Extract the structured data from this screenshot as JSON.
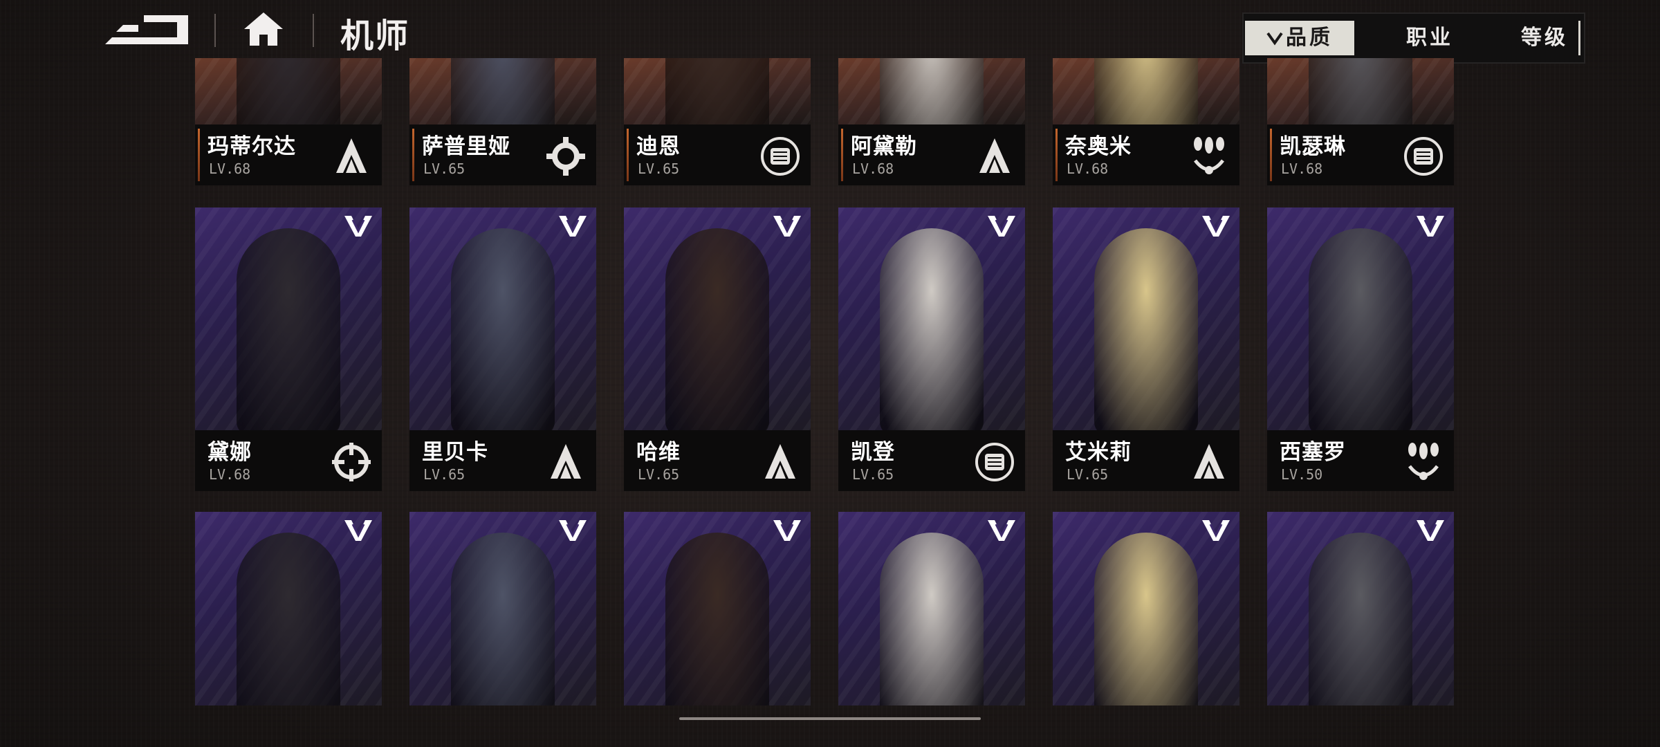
{
  "header": {
    "title": "机师",
    "back_icon": "back-arrow-icon",
    "home_icon": "home-icon"
  },
  "sort": {
    "quality": "品质",
    "job": "职业",
    "level": "等级",
    "quality_indicator": "chevron-down-icon"
  },
  "rows": [
    {
      "cards": [
        {
          "name": "玛蒂尔达",
          "level": "LV.68",
          "job_icon": "lance-icon"
        },
        {
          "name": "萨普里娅",
          "level": "LV.65",
          "job_icon": "wrench-icon"
        },
        {
          "name": "迪恩",
          "level": "LV.65",
          "job_icon": "fist-icon"
        },
        {
          "name": "阿黛勒",
          "level": "LV.68",
          "job_icon": "lance-icon"
        },
        {
          "name": "奈奥米",
          "level": "LV.68",
          "job_icon": "bomb-icon"
        },
        {
          "name": "凯瑟琳",
          "level": "LV.68",
          "job_icon": "fist-icon"
        }
      ]
    },
    {
      "cards": [
        {
          "name": "黛娜",
          "level": "LV.68",
          "job_icon": "crosshair-icon"
        },
        {
          "name": "里贝卡",
          "level": "LV.65",
          "job_icon": "lance-icon"
        },
        {
          "name": "哈维",
          "level": "LV.65",
          "job_icon": "lance-icon"
        },
        {
          "name": "凯登",
          "level": "LV.65",
          "job_icon": "fist-icon"
        },
        {
          "name": "艾米莉",
          "level": "LV.65",
          "job_icon": "lance-icon"
        },
        {
          "name": "西塞罗",
          "level": "LV.50",
          "job_icon": "bomb-icon"
        }
      ]
    },
    {
      "cards": [
        {
          "name": "",
          "level": ""
        },
        {
          "name": "",
          "level": ""
        },
        {
          "name": "",
          "level": ""
        },
        {
          "name": "",
          "level": ""
        },
        {
          "name": "",
          "level": ""
        },
        {
          "name": "",
          "level": ""
        }
      ]
    }
  ],
  "colors": {
    "background": "#1c1716",
    "card_purple": "#3d2a6a",
    "namebar": "#0c0b0b",
    "accent_orange": "#c4662e",
    "sort_selected": "#dfddd6"
  }
}
